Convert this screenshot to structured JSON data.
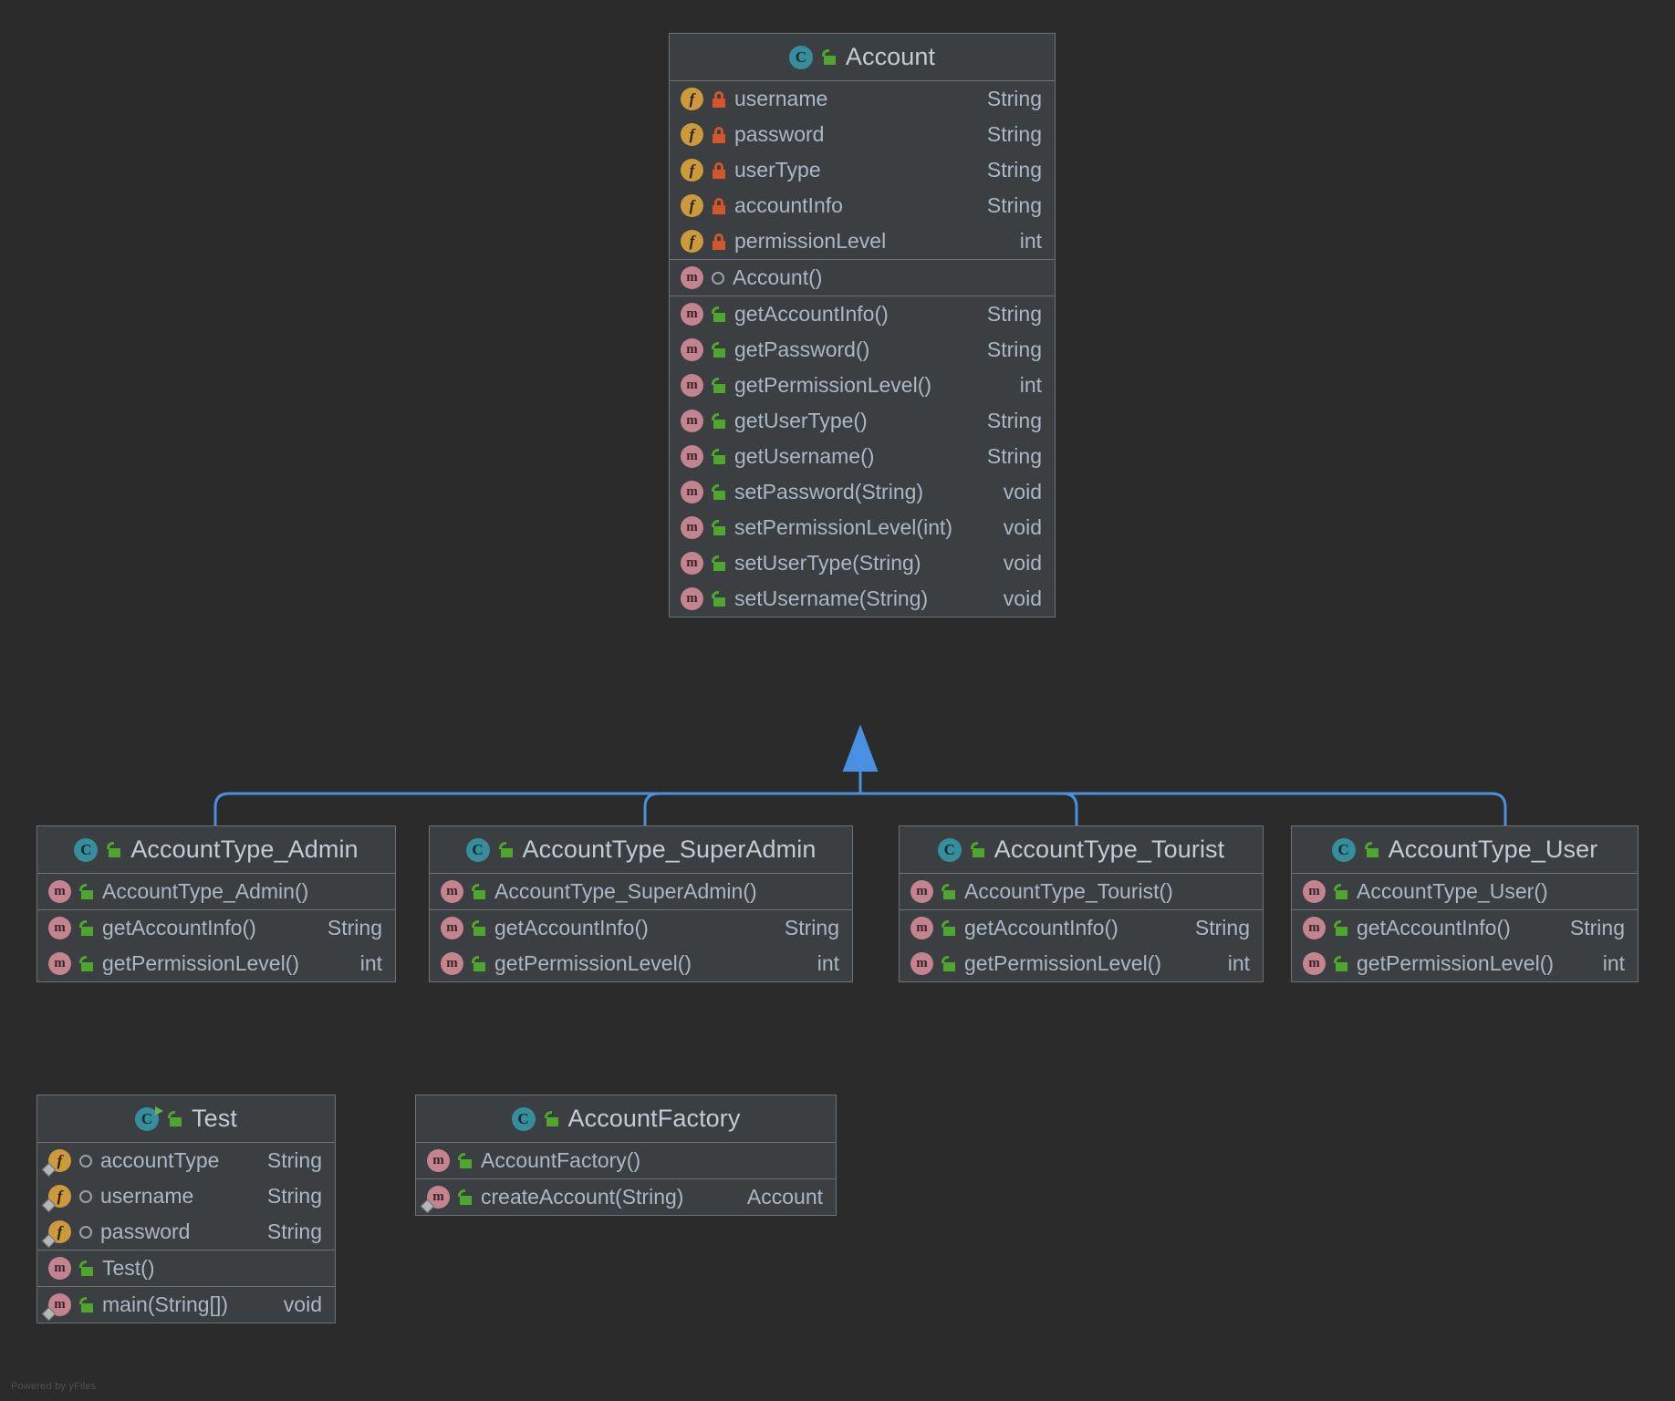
{
  "canvas": {
    "background": "#2b2b2b",
    "watermark": "Powered by yFiles"
  },
  "colors": {
    "node_fill": "#3c3f41",
    "node_border": "#6e7174",
    "text": "#a9b7c6",
    "title_text": "#c3cbd4",
    "edge": "#4a90e2",
    "class_icon": "#368d9b",
    "field_icon": "#cc9a3d",
    "method_icon": "#c3848f",
    "public_lock": "#4fa62f",
    "private_lock": "#d2552b",
    "run_marker": "#5fb84a",
    "static_marker": "#b6b6b6"
  },
  "diagram": {
    "type": "uml-class-diagram",
    "relationship": "generalization",
    "parent": "Account",
    "children": [
      "AccountType_Admin",
      "AccountType_SuperAdmin",
      "AccountType_Tourist",
      "AccountType_User"
    ]
  },
  "classes": [
    {
      "id": "account",
      "name": "Account",
      "icon": "class-icon",
      "visibility": "public",
      "sections": [
        {
          "kind": "fields",
          "members": [
            {
              "icon": "field-icon",
              "visibility": "private",
              "name": "username",
              "type": "String",
              "static": false
            },
            {
              "icon": "field-icon",
              "visibility": "private",
              "name": "password",
              "type": "String",
              "static": false
            },
            {
              "icon": "field-icon",
              "visibility": "private",
              "name": "userType",
              "type": "String",
              "static": false
            },
            {
              "icon": "field-icon",
              "visibility": "private",
              "name": "accountInfo",
              "type": "String",
              "static": false
            },
            {
              "icon": "field-icon",
              "visibility": "private",
              "name": "permissionLevel",
              "type": "int",
              "static": false
            }
          ]
        },
        {
          "kind": "constructors",
          "members": [
            {
              "icon": "method-icon",
              "visibility": "package",
              "name": "Account()",
              "type": "",
              "static": false
            }
          ]
        },
        {
          "kind": "methods",
          "members": [
            {
              "icon": "method-icon",
              "visibility": "public",
              "name": "getAccountInfo()",
              "type": "String",
              "static": false
            },
            {
              "icon": "method-icon",
              "visibility": "public",
              "name": "getPassword()",
              "type": "String",
              "static": false
            },
            {
              "icon": "method-icon",
              "visibility": "public",
              "name": "getPermissionLevel()",
              "type": "int",
              "static": false
            },
            {
              "icon": "method-icon",
              "visibility": "public",
              "name": "getUserType()",
              "type": "String",
              "static": false
            },
            {
              "icon": "method-icon",
              "visibility": "public",
              "name": "getUsername()",
              "type": "String",
              "static": false
            },
            {
              "icon": "method-icon",
              "visibility": "public",
              "name": "setPassword(String)",
              "type": "void",
              "static": false
            },
            {
              "icon": "method-icon",
              "visibility": "public",
              "name": "setPermissionLevel(int)",
              "type": "void",
              "static": false
            },
            {
              "icon": "method-icon",
              "visibility": "public",
              "name": "setUserType(String)",
              "type": "void",
              "static": false
            },
            {
              "icon": "method-icon",
              "visibility": "public",
              "name": "setUsername(String)",
              "type": "void",
              "static": false
            }
          ]
        }
      ]
    },
    {
      "id": "admin",
      "name": "AccountType_Admin",
      "icon": "class-icon",
      "visibility": "public",
      "sections": [
        {
          "kind": "constructors",
          "members": [
            {
              "icon": "method-icon",
              "visibility": "public",
              "name": "AccountType_Admin()",
              "type": "",
              "static": false
            }
          ]
        },
        {
          "kind": "methods",
          "members": [
            {
              "icon": "method-icon",
              "visibility": "public",
              "name": "getAccountInfo()",
              "type": "String",
              "static": false
            },
            {
              "icon": "method-icon",
              "visibility": "public",
              "name": "getPermissionLevel()",
              "type": "int",
              "static": false
            }
          ]
        }
      ]
    },
    {
      "id": "superadmin",
      "name": "AccountType_SuperAdmin",
      "icon": "class-icon",
      "visibility": "public",
      "sections": [
        {
          "kind": "constructors",
          "members": [
            {
              "icon": "method-icon",
              "visibility": "public",
              "name": "AccountType_SuperAdmin()",
              "type": "",
              "static": false
            }
          ]
        },
        {
          "kind": "methods",
          "members": [
            {
              "icon": "method-icon",
              "visibility": "public",
              "name": "getAccountInfo()",
              "type": "String",
              "static": false
            },
            {
              "icon": "method-icon",
              "visibility": "public",
              "name": "getPermissionLevel()",
              "type": "int",
              "static": false
            }
          ]
        }
      ]
    },
    {
      "id": "tourist",
      "name": "AccountType_Tourist",
      "icon": "class-icon",
      "visibility": "public",
      "sections": [
        {
          "kind": "constructors",
          "members": [
            {
              "icon": "method-icon",
              "visibility": "public",
              "name": "AccountType_Tourist()",
              "type": "",
              "static": false
            }
          ]
        },
        {
          "kind": "methods",
          "members": [
            {
              "icon": "method-icon",
              "visibility": "public",
              "name": "getAccountInfo()",
              "type": "String",
              "static": false
            },
            {
              "icon": "method-icon",
              "visibility": "public",
              "name": "getPermissionLevel()",
              "type": "int",
              "static": false
            }
          ]
        }
      ]
    },
    {
      "id": "user",
      "name": "AccountType_User",
      "icon": "class-icon",
      "visibility": "public",
      "sections": [
        {
          "kind": "constructors",
          "members": [
            {
              "icon": "method-icon",
              "visibility": "public",
              "name": "AccountType_User()",
              "type": "",
              "static": false
            }
          ]
        },
        {
          "kind": "methods",
          "members": [
            {
              "icon": "method-icon",
              "visibility": "public",
              "name": "getAccountInfo()",
              "type": "String",
              "static": false
            },
            {
              "icon": "method-icon",
              "visibility": "public",
              "name": "getPermissionLevel()",
              "type": "int",
              "static": false
            }
          ]
        }
      ]
    },
    {
      "id": "test",
      "name": "Test",
      "icon": "runnable-class-icon",
      "visibility": "public",
      "sections": [
        {
          "kind": "fields",
          "members": [
            {
              "icon": "field-icon",
              "visibility": "package",
              "name": "accountType",
              "type": "String",
              "static": true
            },
            {
              "icon": "field-icon",
              "visibility": "package",
              "name": "username",
              "type": "String",
              "static": true
            },
            {
              "icon": "field-icon",
              "visibility": "package",
              "name": "password",
              "type": "String",
              "static": true
            }
          ]
        },
        {
          "kind": "constructors",
          "members": [
            {
              "icon": "method-icon",
              "visibility": "public",
              "name": "Test()",
              "type": "",
              "static": false
            }
          ]
        },
        {
          "kind": "methods",
          "members": [
            {
              "icon": "method-icon",
              "visibility": "public",
              "name": "main(String[])",
              "type": "void",
              "static": true
            }
          ]
        }
      ]
    },
    {
      "id": "factory",
      "name": "AccountFactory",
      "icon": "class-icon",
      "visibility": "public",
      "sections": [
        {
          "kind": "constructors",
          "members": [
            {
              "icon": "method-icon",
              "visibility": "public",
              "name": "AccountFactory()",
              "type": "",
              "static": false
            }
          ]
        },
        {
          "kind": "methods",
          "members": [
            {
              "icon": "method-icon",
              "visibility": "public",
              "name": "createAccount(String)",
              "type": "Account",
              "static": true
            }
          ]
        }
      ]
    }
  ]
}
